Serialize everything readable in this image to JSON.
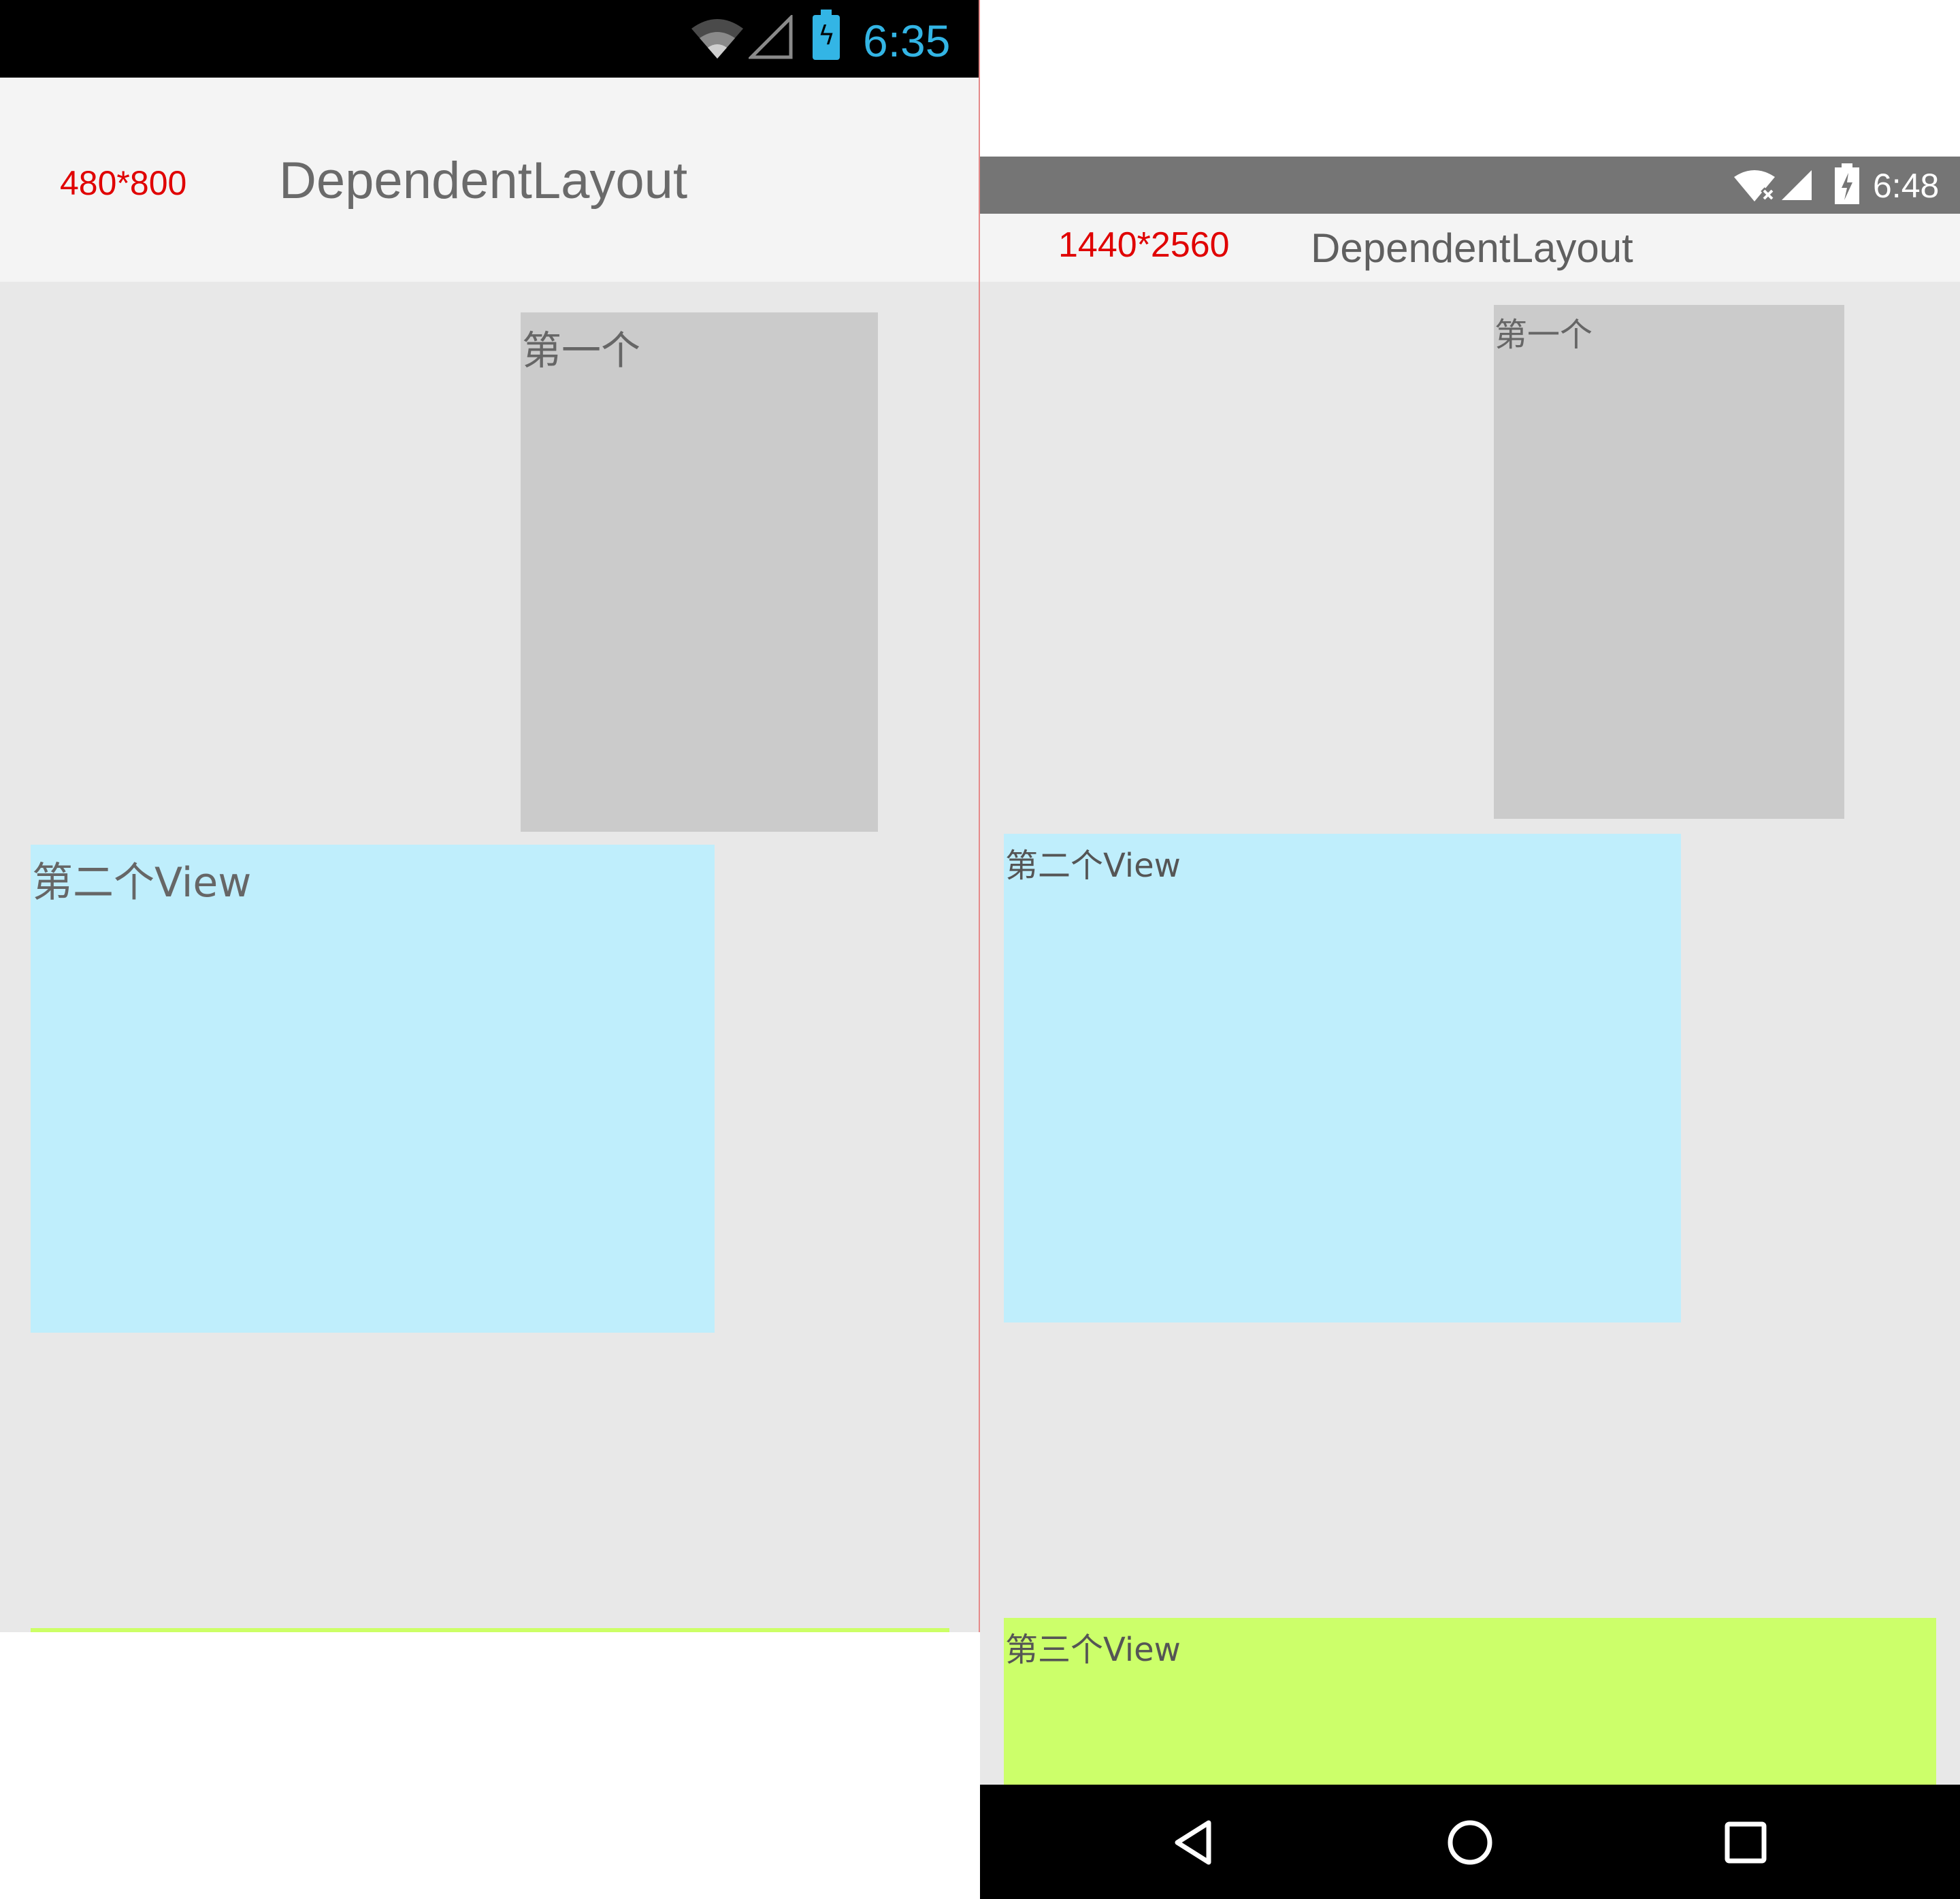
{
  "left_phone": {
    "status_time": "6:35",
    "resolution_label": "480*800",
    "app_title": "DependentLayout",
    "view1_text": "第一个",
    "view2_text": "第二个View"
  },
  "right_phone": {
    "status_time": "6:48",
    "resolution_label": "1440*2560",
    "app_title": "DependentLayout",
    "view1_text": "第一个",
    "view2_text": "第二个View",
    "view3_text": "第三个View"
  },
  "colors": {
    "left_status_accent": "#33b5e5",
    "label_red": "#e00000",
    "view1_bg": "#cbcbcb",
    "view2_bg": "#bfeefc",
    "view3_bg": "#ccff66",
    "content_bg": "#e8e8e8"
  },
  "icons": {
    "left_status": [
      "wifi-icon",
      "cell-signal-icon",
      "battery-charging-icon"
    ],
    "right_status": [
      "wifi-no-internet-icon",
      "cell-signal-icon",
      "battery-charging-icon"
    ],
    "right_navbar": [
      "back-icon",
      "home-icon",
      "recents-icon"
    ]
  }
}
